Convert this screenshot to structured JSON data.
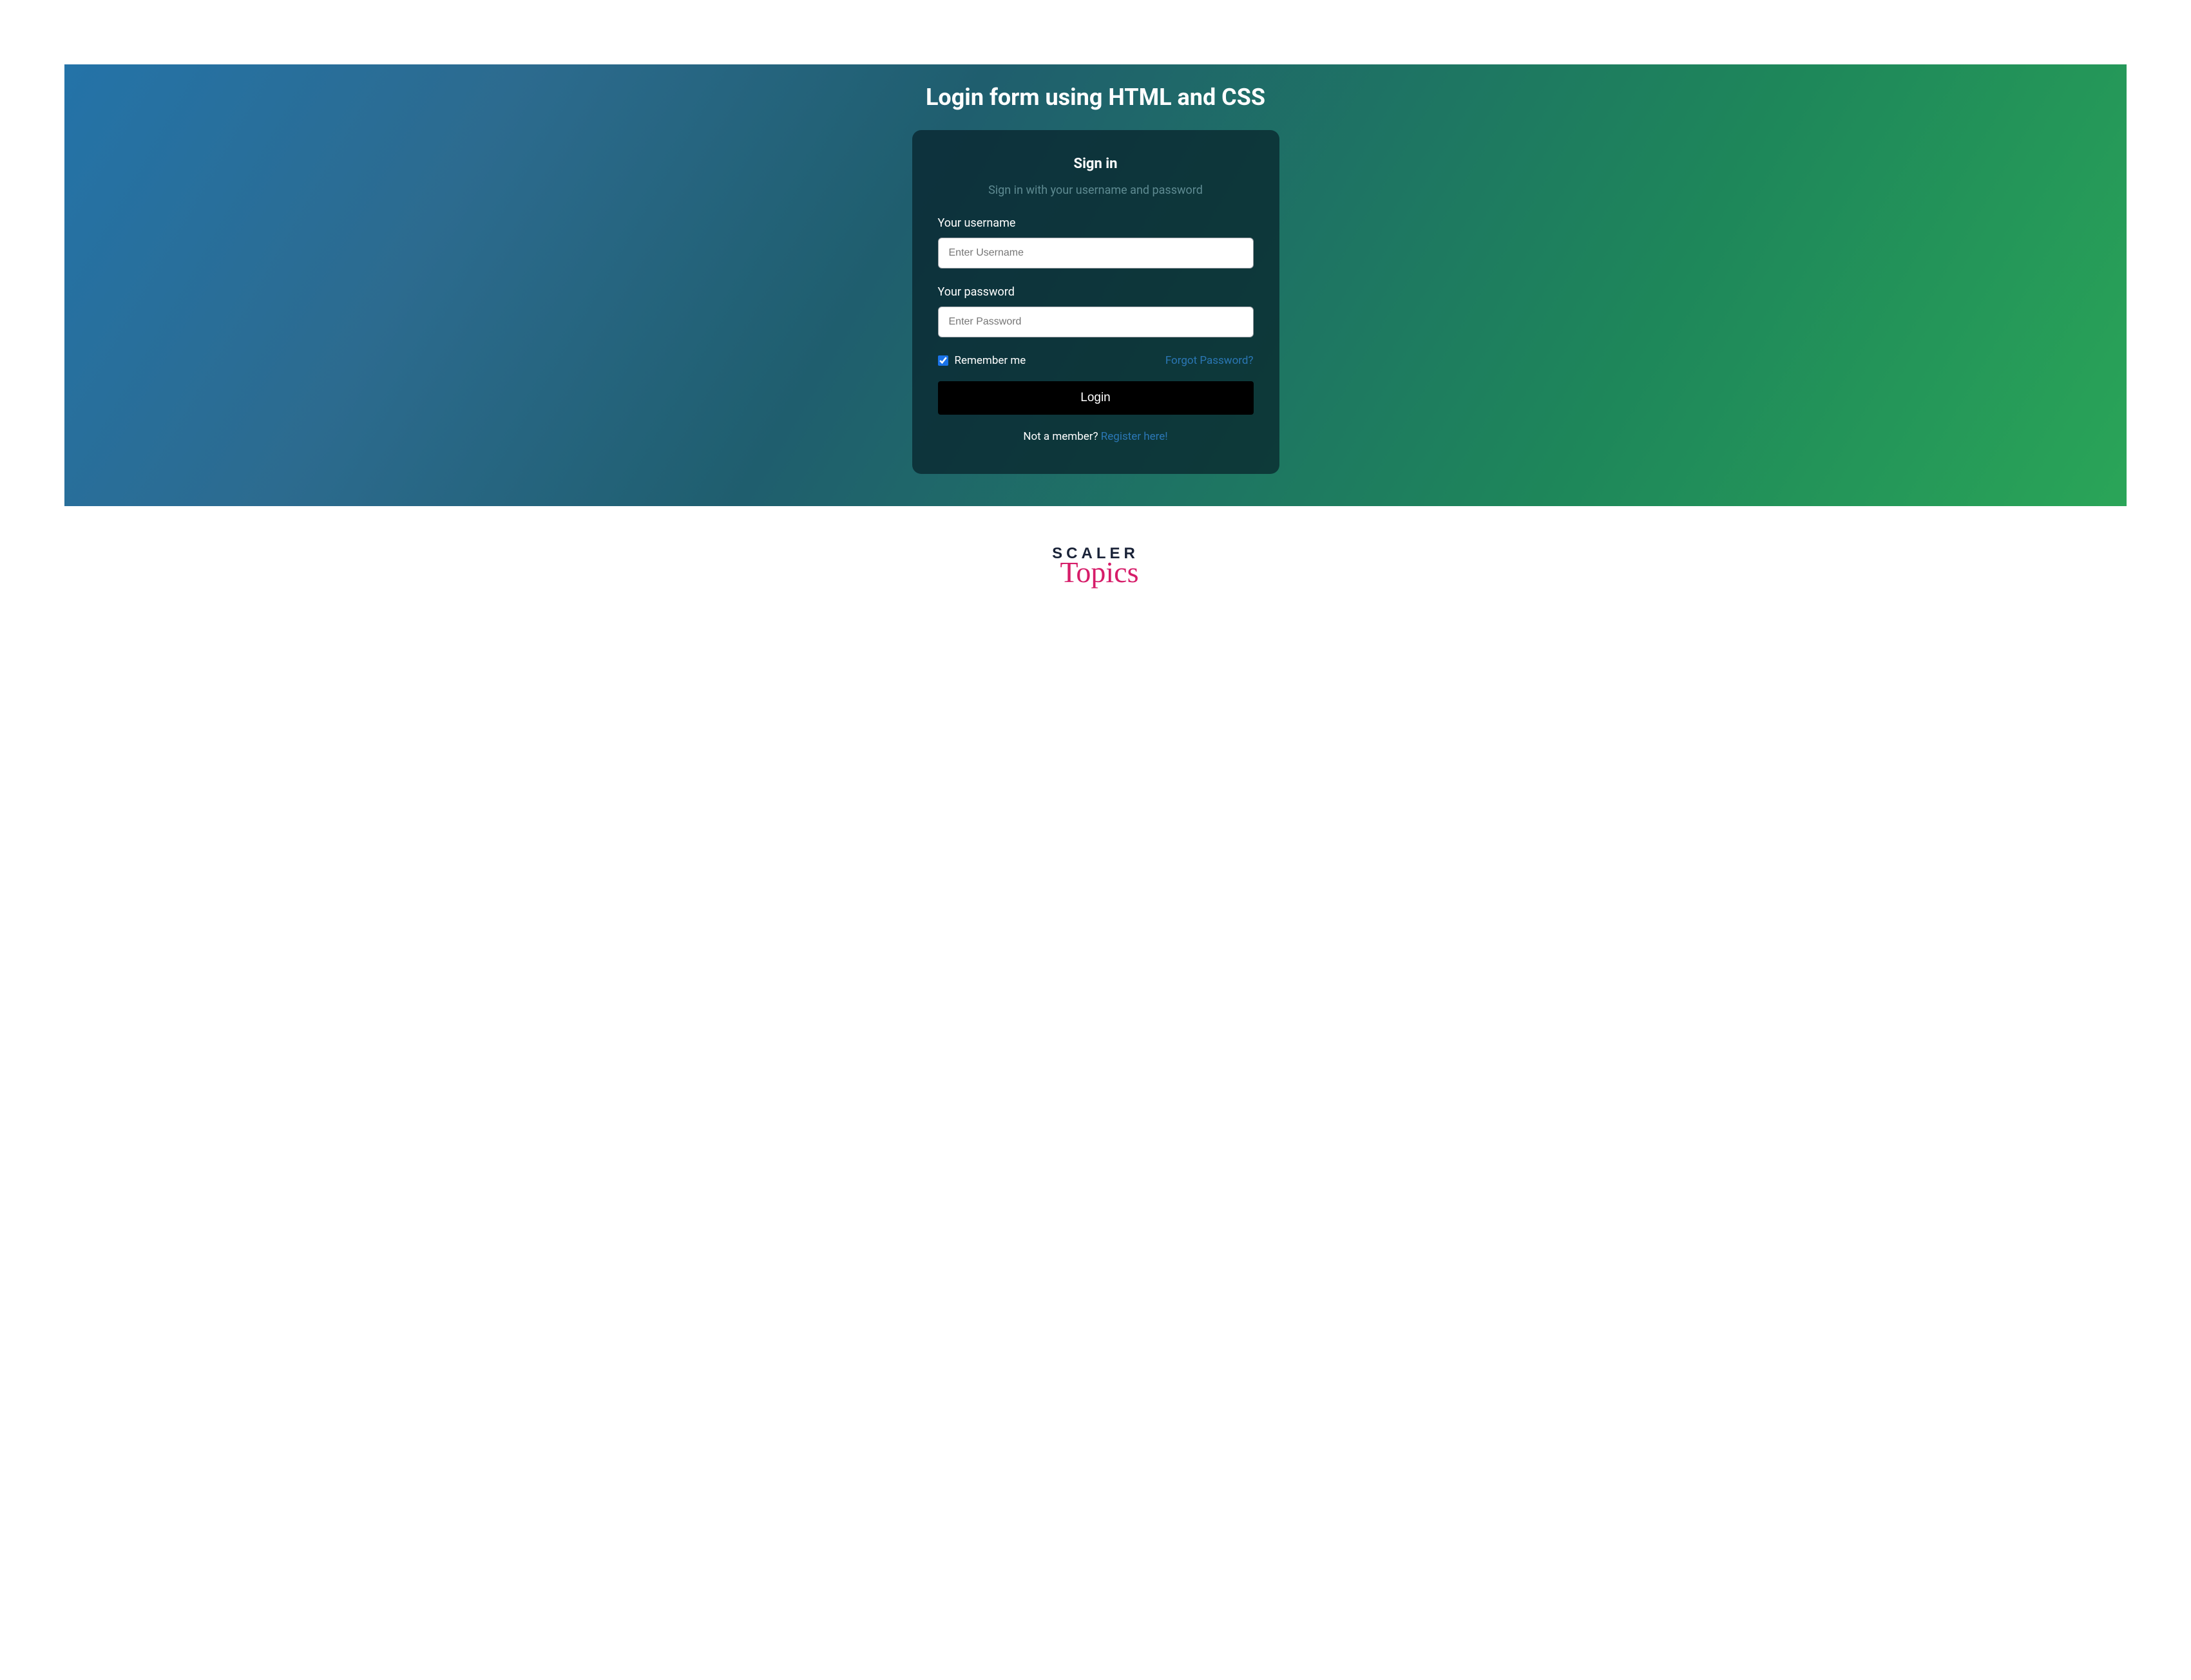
{
  "page": {
    "title": "Login form using HTML and CSS"
  },
  "card": {
    "heading": "Sign in",
    "subheading": "Sign in with your username and password"
  },
  "fields": {
    "username_label": "Your username",
    "username_placeholder": "Enter Username",
    "username_value": "",
    "password_label": "Your password",
    "password_placeholder": "Enter Password",
    "password_value": ""
  },
  "options": {
    "remember_label": "Remember me",
    "remember_checked": true,
    "forgot_label": "Forgot Password?"
  },
  "actions": {
    "login_label": "Login"
  },
  "register": {
    "prompt": "Not a member? ",
    "link_label": "Register here!"
  },
  "brand": {
    "line1": "SCALER",
    "line2": "Topics"
  }
}
